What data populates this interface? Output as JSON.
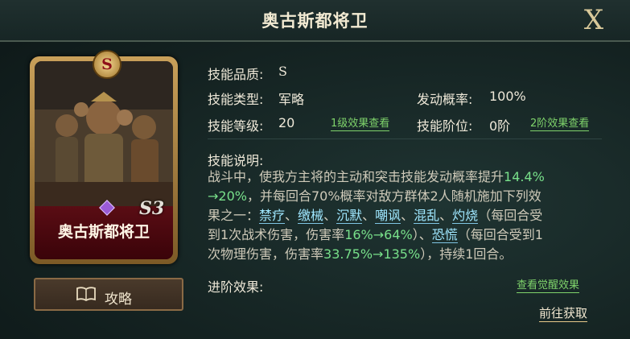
{
  "title": "奥古斯都将卫",
  "close_label": "X",
  "card": {
    "name": "奥古斯都将卫",
    "grade_badge": "S",
    "stamp": "S3"
  },
  "guide_button": "攻略",
  "info": {
    "quality_label": "技能品质:",
    "quality_value": "S",
    "type_label": "技能类型:",
    "type_value": "军略",
    "chance_label": "发动概率:",
    "chance_value": "100%",
    "level_label": "技能等级:",
    "level_value": "20",
    "level_link": "1级效果查看",
    "stage_label": "技能阶位:",
    "stage_value": "0阶",
    "stage_link": "2阶效果查看"
  },
  "description": {
    "label": "技能说明:",
    "p1": "战斗中，使我方主将的主动和突击技能发动概率提升",
    "v1": "14.4%",
    "v2": "→20%",
    "p2": "，并每回合70%概率对敌方群体2人随机施加下列效",
    "p3": "果之一：",
    "effect1": "禁疗",
    "sep1": "、",
    "effect2": "缴械",
    "sep2": "、",
    "effect3": "沉默",
    "sep3": "、",
    "effect4": "嘲讽",
    "sep4": "、",
    "effect5": "混乱",
    "sep5": "、",
    "effect6": "灼烧",
    "p4": "（每回合受",
    "p5": "到1次战术伤害，伤害率",
    "v3": "16%",
    "v4": "→64%",
    "p6": "）、",
    "effect7": "恐慌",
    "p7": "（每回合受到1",
    "p8": "次物理伤害，伤害率",
    "v5": "33.75%",
    "v6": "→135%",
    "p9": "），持续1回合。"
  },
  "advance": {
    "label": "进阶效果:",
    "link": "查看觉醒效果"
  },
  "goto_button": "前往获取",
  "colors": {
    "accent_green": "#78e08a",
    "tag_blue": "#9fe7ff",
    "card_red": "#5a0d14"
  }
}
